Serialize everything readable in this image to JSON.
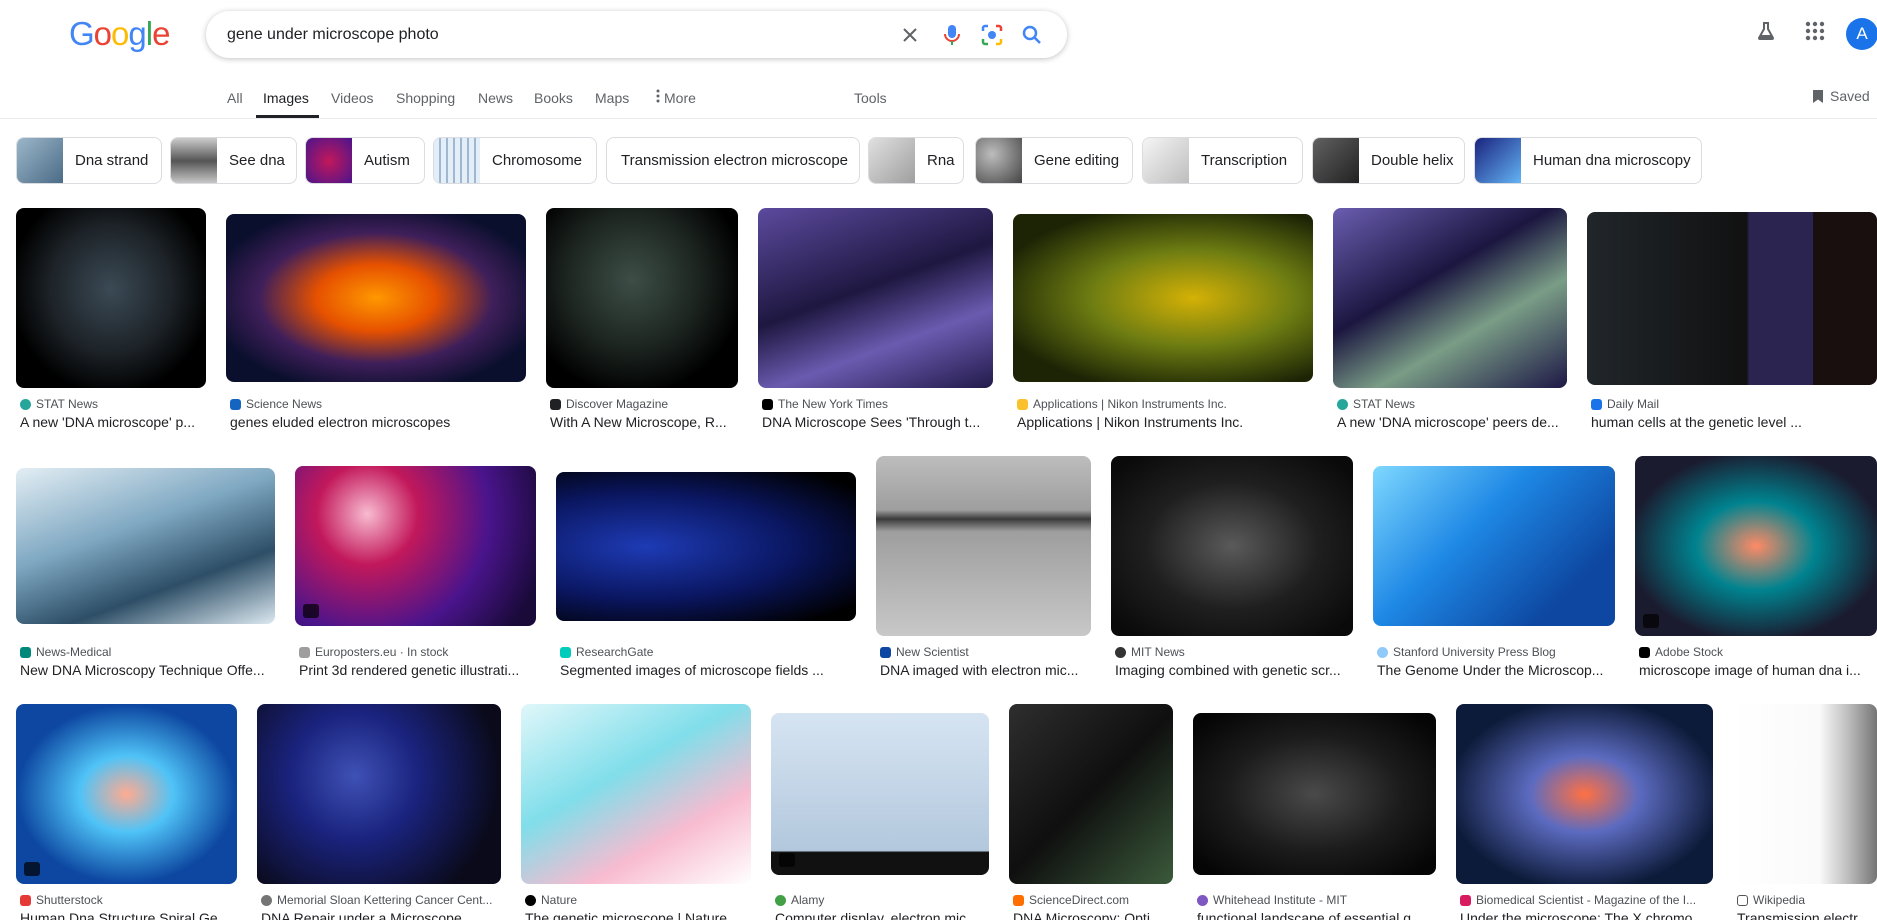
{
  "logo": "Google",
  "search": {
    "value": "gene under microscope photo"
  },
  "user": {
    "initial": "A"
  },
  "nav": {
    "items": [
      "All",
      "Images",
      "Videos",
      "Shopping",
      "News",
      "Books",
      "Maps",
      "More"
    ],
    "tools": "Tools",
    "saved": "Saved",
    "active": "Images"
  },
  "chips": [
    {
      "label": "Dna strand"
    },
    {
      "label": "See dna"
    },
    {
      "label": "Autism"
    },
    {
      "label": "Chromosome"
    },
    {
      "label": "Transmission electron microscope"
    },
    {
      "label": "Rna"
    },
    {
      "label": "Gene editing"
    },
    {
      "label": "Transcription"
    },
    {
      "label": "Double helix"
    },
    {
      "label": "Human dna microscopy"
    }
  ],
  "results": [
    {
      "source": "STAT News",
      "title": "A new 'DNA microscope' p..."
    },
    {
      "source": "Science News",
      "title": "genes eluded electron microscopes"
    },
    {
      "source": "Discover Magazine",
      "title": "With A New Microscope, R..."
    },
    {
      "source": "The New York Times",
      "title": "DNA Microscope Sees 'Through t..."
    },
    {
      "source": "Applications | Nikon Instruments Inc.",
      "title": "Applications | Nikon Instruments Inc."
    },
    {
      "source": "STAT News",
      "title": "A new 'DNA microscope' peers de..."
    },
    {
      "source": "Daily Mail",
      "title": "human cells at the genetic level ..."
    },
    {
      "source": "News-Medical",
      "title": "New DNA Microscopy Technique Offe..."
    },
    {
      "source": "Europosters.eu · In stock",
      "title": "Print 3d rendered genetic illustrati..."
    },
    {
      "source": "ResearchGate",
      "title": "Segmented images of microscope fields ..."
    },
    {
      "source": "New Scientist",
      "title": "DNA imaged with electron mic..."
    },
    {
      "source": "MIT News",
      "title": "Imaging combined with genetic scr..."
    },
    {
      "source": "Stanford University Press Blog",
      "title": "The Genome Under the Microscop..."
    },
    {
      "source": "Adobe Stock",
      "title": "microscope image of human dna i..."
    },
    {
      "source": "Shutterstock",
      "title": "Human Dna Structure Spiral Ge..."
    },
    {
      "source": "Memorial Sloan Kettering Cancer Cent...",
      "title": "DNA Repair under a Microscope ..."
    },
    {
      "source": "Nature",
      "title": "The genetic microscope | Nature ..."
    },
    {
      "source": "Alamy",
      "title": "Computer display, electron mic..."
    },
    {
      "source": "ScienceDirect.com",
      "title": "DNA Microscopy: Opti..."
    },
    {
      "source": "Whitehead Institute - MIT",
      "title": "functional landscape of essential g..."
    },
    {
      "source": "Biomedical Scientist - Magazine of the I...",
      "title": "Under the microscope: The X chromo..."
    },
    {
      "source": "Wikipedia",
      "title": "Transmission electr..."
    }
  ],
  "colors": {
    "accent": "#1a73e8",
    "text": "#202124",
    "muted": "#5f6368"
  }
}
